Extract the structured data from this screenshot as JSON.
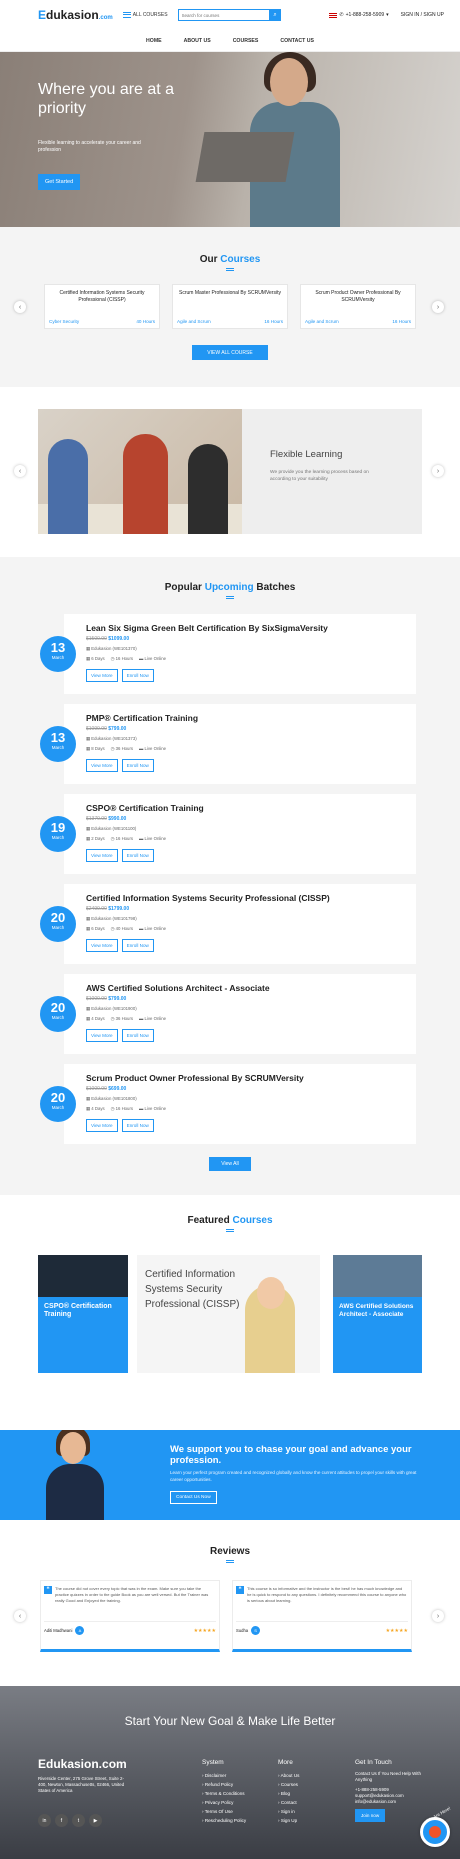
{
  "header": {
    "logo_E": "E",
    "logo_rest": "dukasion",
    "logo_tld": ".com",
    "all_courses": "ALL COURSES",
    "search_placeholder": "Search for courses",
    "phone": "+1-888-258-5909",
    "sign_in": "SIGN IN / SIGN UP"
  },
  "nav": [
    "HOME",
    "ABOUT US",
    "COURSES",
    "CONTACT US"
  ],
  "hero": {
    "title": "Where you are at a priority",
    "subtitle": "Flexible learning to accelerate your career and profession",
    "cta": "Get Started"
  },
  "courses": {
    "title_a": "Our ",
    "title_b": "Courses",
    "view_all": "VIEW ALL COURSE",
    "items": [
      {
        "title": "Certified Information Systems Security Professional (CISSP)",
        "category": "Cyber Security",
        "hours": "40 Hours"
      },
      {
        "title": "Scrum Master Professional By SCRUMVersity",
        "category": "Agile and Scrum",
        "hours": "16 Hours"
      },
      {
        "title": "Scrum Product Owner Professional By SCRUMVersity",
        "category": "Agile and Scrum",
        "hours": "16 Hours"
      }
    ]
  },
  "flexible": {
    "title": "Flexible Learning",
    "text": "We provide you the learning process based on according to your suitability"
  },
  "batches": {
    "title_a": "Popular ",
    "title_b": "Upcoming",
    "title_c": " Batches",
    "view_more": "View More",
    "enroll": "Enroll Now",
    "view_all": "View All",
    "items": [
      {
        "day": "13",
        "month": "March",
        "title": "Lean Six Sigma Green Belt Certification By SixSigmaVersity",
        "old": "$1500.00",
        "new": "$1099.00",
        "provider": "Edukasion (WE101370)",
        "days": "6 Days",
        "hours": "16 Hours",
        "mode": "Live Online"
      },
      {
        "day": "13",
        "month": "March",
        "title": "PMP® Certification Training",
        "old": "$1099.00",
        "new": "$799.00",
        "provider": "Edukasion (WE101373)",
        "days": "8 Days",
        "hours": "36 Hours",
        "mode": "Live Online"
      },
      {
        "day": "19",
        "month": "March",
        "title": "CSPO® Certification Training",
        "old": "$1370.00",
        "new": "$990.00",
        "provider": "Edukasion (WE101100)",
        "days": "2 Days",
        "hours": "16 Hours",
        "mode": "Live Online"
      },
      {
        "day": "20",
        "month": "March",
        "title": "Certified Information Systems Security Professional (CISSP)",
        "old": "$2499.00",
        "new": "$1799.00",
        "provider": "Edukasion (WE101798)",
        "days": "6 Days",
        "hours": "40 Hours",
        "mode": "Live Online"
      },
      {
        "day": "20",
        "month": "March",
        "title": "AWS Certified Solutions Architect - Associate",
        "old": "$1000.00",
        "new": "$799.00",
        "provider": "Edukasion (WE101900)",
        "days": "4 Days",
        "hours": "36 Hours",
        "mode": "Live Online"
      },
      {
        "day": "20",
        "month": "March",
        "title": "Scrum Product Owner Professional By SCRUMVersity",
        "old": "$1000.00",
        "new": "$699.00",
        "provider": "Edukasion (WE101800)",
        "days": "4 Days",
        "hours": "16 Hours",
        "mode": "Live Online"
      }
    ]
  },
  "featured": {
    "title_a": "Featured ",
    "title_b": "Courses",
    "c1": "CSPO® Certification Training",
    "c2": "Certified Information Systems Security Professional (CISSP)",
    "c3": "AWS Certified Solutions Architect - Associate"
  },
  "support": {
    "title": "We support you to chase your goal and advance your profession.",
    "text": "Learn your perfect program created and recognized globally and know the current attitudes to propel your skills with great career opportunities.",
    "button": "Contact Us Now"
  },
  "reviews": {
    "title": "Reviews",
    "items": [
      {
        "text": "The course did not cover every topic that was in the exam. Make sure you take the practice quizzes in order to the guide Book as you are well versed. But the Trainer was really Good and Enjoyed the training.",
        "name": "Aditi Madhwani",
        "initial": "A",
        "stars": "★★★★★"
      },
      {
        "text": "This course is so informative and the instructor is the best! he has much knowledge and he is quick to respond to any questions. I definitely recommend this course to anyone who is serious about learning.",
        "name": "Sudha",
        "initial": "S",
        "stars": "★★★★★"
      }
    ]
  },
  "footer": {
    "tagline": "Start Your New Goal & Make Life Better",
    "logo": "Edukasion.com",
    "address": "Riverside Center, 275 Grove Street, Suite 2-400, Newton, Massachusetts, 02466, United States of America",
    "system_h": "System",
    "system": [
      "Disclaimer",
      "Refund Policy",
      "Terms & Conditions",
      "Privacy Policy",
      "Terms Of Use",
      "Rescheduling Policy"
    ],
    "more_h": "More",
    "more": [
      "About Us",
      "Courses",
      "Blog",
      "Contact",
      "Sign in",
      "Sign Up"
    ],
    "touch_h": "Get In Touch",
    "touch_text": "Contact Us If You Need Help With Anything",
    "touch_phone": "+1-888-258-5909",
    "touch_email": "support@edukasion.com",
    "touch_email2": "info@edukasion.com",
    "join": "Join now",
    "badge": "We Are Here!"
  },
  "colors": {
    "accent": "#2196f3"
  }
}
